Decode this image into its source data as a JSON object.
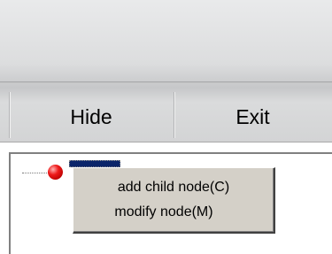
{
  "toolbar": {
    "hide_label": "Hide",
    "exit_label": "Exit"
  },
  "context_menu": {
    "items": [
      {
        "label": "add child node(C)"
      },
      {
        "label": "modify node(M)"
      }
    ]
  }
}
